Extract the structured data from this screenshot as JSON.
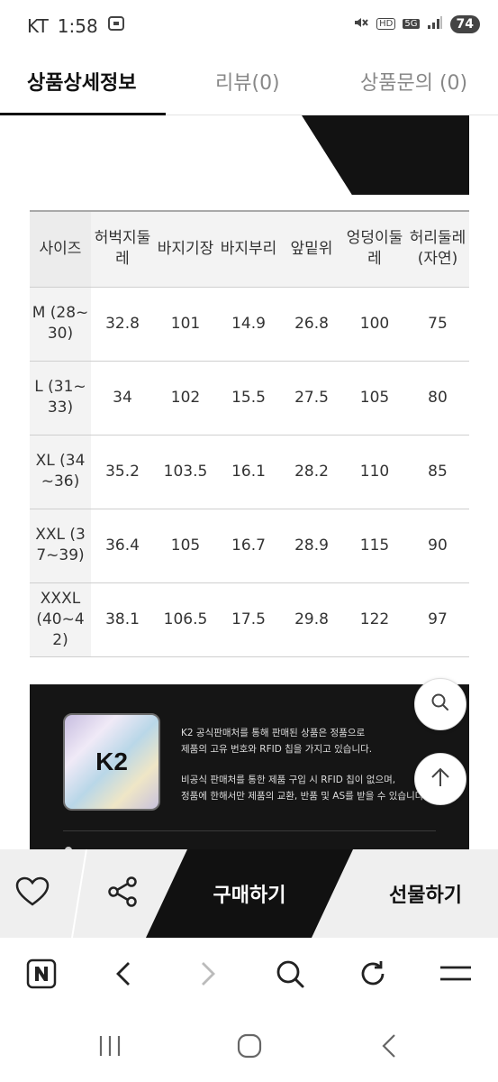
{
  "status_bar": {
    "carrier": "KT",
    "time": "1:58",
    "network_badge_1": "HD",
    "network_badge_2": "5G",
    "battery": "74"
  },
  "tabs": [
    {
      "label": "상품상세정보",
      "active": true
    },
    {
      "label": "리뷰(0)",
      "active": false
    },
    {
      "label": "상품문의 (0)",
      "active": false
    }
  ],
  "size_table": {
    "headers": [
      "사이즈",
      "허벅지둘레",
      "바지기장",
      "바지부리",
      "앞밑위",
      "엉덩이둘레",
      "허리둘레(자연)"
    ],
    "rows": [
      {
        "size": "M (28~30)",
        "values": [
          "32.8",
          "101",
          "14.9",
          "26.8",
          "100",
          "75"
        ]
      },
      {
        "size": "L (31~33)",
        "values": [
          "34",
          "102",
          "15.5",
          "27.5",
          "105",
          "80"
        ]
      },
      {
        "size": "XL (34~36)",
        "values": [
          "35.2",
          "103.5",
          "16.1",
          "28.2",
          "110",
          "85"
        ]
      },
      {
        "size": "XXL (37~39)",
        "values": [
          "36.4",
          "105",
          "16.7",
          "28.9",
          "115",
          "90"
        ]
      },
      {
        "size": "XXXL (40~42)",
        "values": [
          "38.1",
          "106.5",
          "17.5",
          "29.8",
          "122",
          "97"
        ]
      }
    ]
  },
  "k2_notice": {
    "logo_text": "K2",
    "line1": "K2 공식판매처를 통해 판매된 상품은 정품으로",
    "line2": "제품의 고유 번호와 RFID 칩을 가지고 있습니다.",
    "line3": "비공식 판매처를 통한 제품 구입 시 RFID 칩이 없으며,",
    "line4": "정품에 한해서만 제품의 교환, 반품 및 AS를 받을 수 있습니다."
  },
  "action_bar": {
    "buy_label": "구매하기",
    "gift_label": "선물하기"
  },
  "colors": {
    "accent_dark": "#111111",
    "action_bg": "#efefef",
    "table_header_bg": "#f3f3f3"
  }
}
